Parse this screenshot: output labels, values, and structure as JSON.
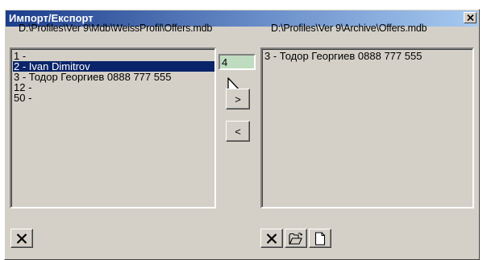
{
  "window": {
    "title": "Импорт/Експорт"
  },
  "paths": {
    "left": "D:\\Profiles\\Ver 9\\Mdb\\WeissProfil\\Offers.mdb",
    "right": "D:\\Profiles\\Ver 9\\Archive\\Offers.mdb"
  },
  "left_list": {
    "items": [
      {
        "label": "1 -",
        "selected": false
      },
      {
        "label": "2 - Ivan Dimitrov",
        "selected": true
      },
      {
        "label": "3 - Тодор Георгиев 0888 777 555",
        "selected": false
      },
      {
        "label": "12 -",
        "selected": false
      },
      {
        "label": "50 -",
        "selected": false
      }
    ]
  },
  "right_list": {
    "items": [
      {
        "label": "3 - Тодор Георгиев 0888 777 555",
        "selected": false
      }
    ]
  },
  "number_input": {
    "value": "4"
  },
  "buttons": {
    "move_right_label": ">",
    "move_left_label": "<"
  },
  "icons": {
    "close": "close-icon",
    "delete": "x-icon",
    "open": "folder-open-icon",
    "new": "new-document-icon",
    "cursor": "mouse-pointer-icon"
  },
  "colors": {
    "selection": "#0a246a",
    "input_background": "#c0dcc0",
    "title_gradient_start": "#1c3e8c",
    "title_gradient_end": "#a6caf0"
  }
}
